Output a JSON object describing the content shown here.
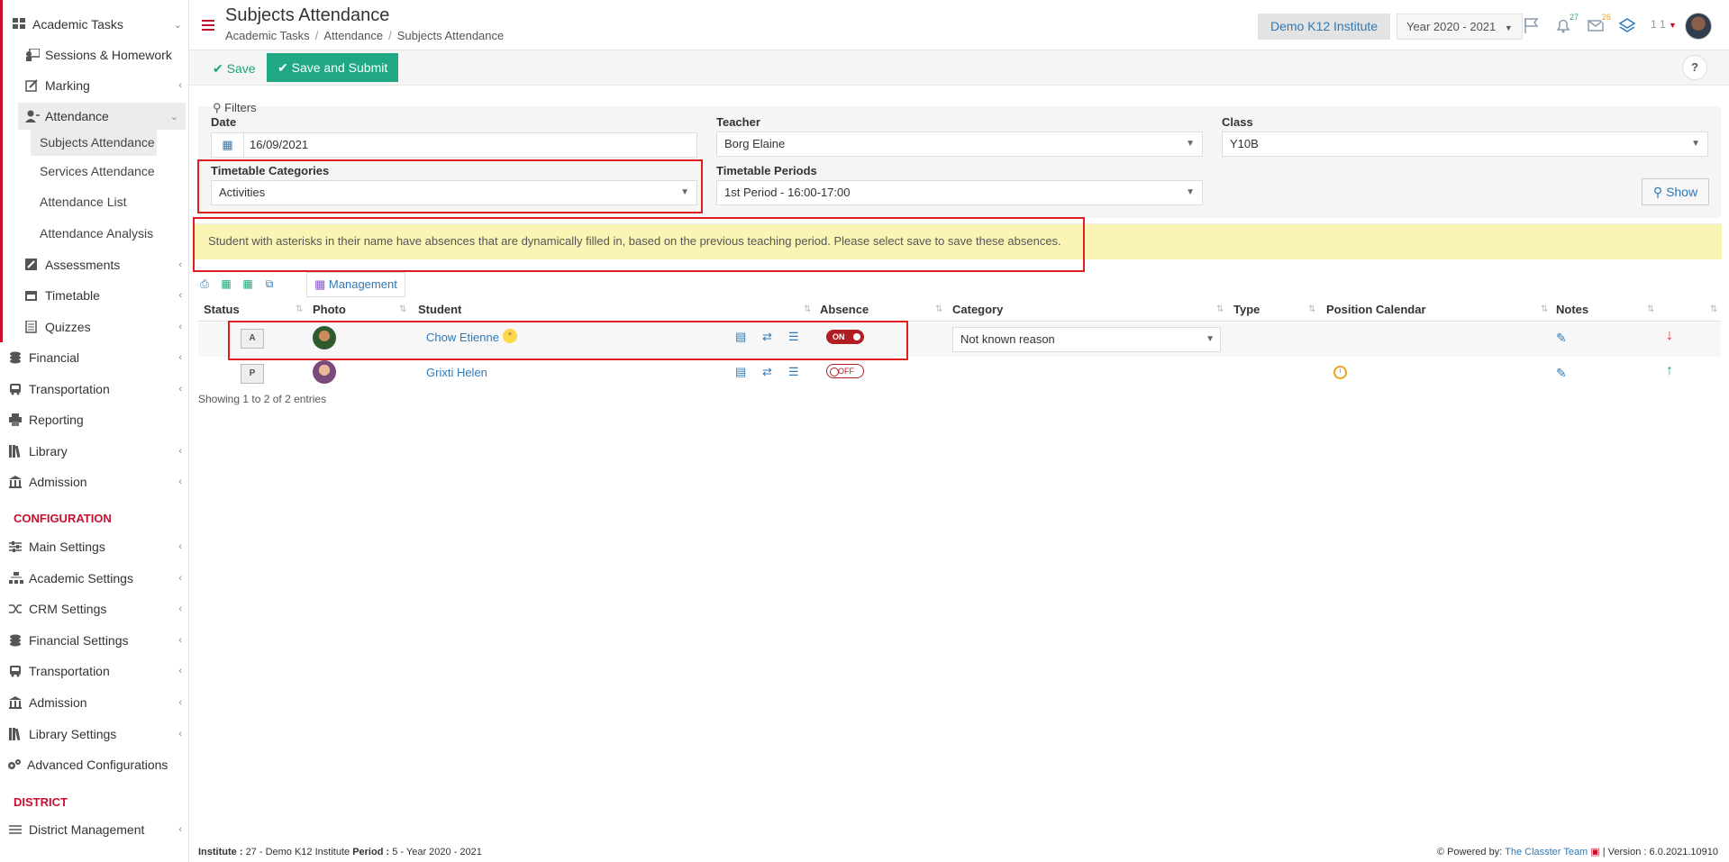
{
  "sidebar": {
    "items": [
      {
        "label": "Academic Tasks",
        "icon": "grid-icon",
        "has_chevron": true
      },
      {
        "label": "Sessions & Homework",
        "icon": "teacher-icon",
        "has_chevron": false
      },
      {
        "label": "Marking",
        "icon": "edit-icon",
        "has_chevron": true
      },
      {
        "label": "Attendance",
        "icon": "user-icon",
        "has_chevron": true
      },
      {
        "label": "Subjects Attendance",
        "icon": "",
        "has_chevron": false,
        "active": true
      },
      {
        "label": "Services Attendance",
        "icon": "",
        "has_chevron": false
      },
      {
        "label": "Attendance List",
        "icon": "",
        "has_chevron": false
      },
      {
        "label": "Attendance Analysis",
        "icon": "",
        "has_chevron": false
      },
      {
        "label": "Assessments",
        "icon": "pencil-square-icon",
        "has_chevron": true
      },
      {
        "label": "Timetable",
        "icon": "calendar-icon",
        "has_chevron": true
      },
      {
        "label": "Quizzes",
        "icon": "quiz-icon",
        "has_chevron": true
      },
      {
        "label": "Financial",
        "icon": "coins-icon",
        "has_chevron": true
      },
      {
        "label": "Transportation",
        "icon": "bus-icon",
        "has_chevron": true
      },
      {
        "label": "Reporting",
        "icon": "print-icon",
        "has_chevron": false
      },
      {
        "label": "Library",
        "icon": "books-icon",
        "has_chevron": true
      },
      {
        "label": "Admission",
        "icon": "institution-icon",
        "has_chevron": true
      }
    ],
    "config_title": "CONFIGURATION",
    "config_items": [
      {
        "label": "Main Settings",
        "icon": "sliders-icon"
      },
      {
        "label": "Academic Settings",
        "icon": "sitemap-icon"
      },
      {
        "label": "CRM Settings",
        "icon": "shuffle-icon"
      },
      {
        "label": "Financial Settings",
        "icon": "coins-icon"
      },
      {
        "label": "Transportation",
        "icon": "bus-icon"
      },
      {
        "label": "Admission",
        "icon": "institution-icon"
      },
      {
        "label": "Library Settings",
        "icon": "books-icon"
      },
      {
        "label": "Advanced Configurations",
        "icon": "gears-icon"
      }
    ],
    "district_title": "DISTRICT",
    "district_items": [
      {
        "label": "District Management",
        "icon": "list-icon"
      }
    ]
  },
  "header": {
    "title": "Subjects Attendance",
    "breadcrumb": [
      "Academic Tasks",
      "Attendance",
      "Subjects Attendance"
    ],
    "institute": "Demo K12 Institute",
    "year": "Year 2020 - 2021",
    "notifications_count": "27",
    "messages_count": "26",
    "user_short": "1 1"
  },
  "toolbar": {
    "save_label": "Save",
    "submit_label": "Save and Submit",
    "help_label": "?"
  },
  "filters": {
    "title": "Filters",
    "date_label": "Date",
    "date_value": "16/09/2021",
    "teacher_label": "Teacher",
    "teacher_value": "Borg Elaine",
    "class_label": "Class",
    "class_value": "Y10B",
    "categories_label": "Timetable Categories",
    "categories_value": "Activities",
    "periods_label": "Timetable Periods",
    "periods_value": "1st Period - 16:00-17:00",
    "show_label": "Show"
  },
  "note": "Student with asterisks in their name have absences that are dynamically filled in, based on the previous teaching period. Please select save to save these absences.",
  "table": {
    "management_label": "Management",
    "columns": [
      "Status",
      "Photo",
      "Student",
      "Absence",
      "Category",
      "Type",
      "Position Calendar",
      "Notes"
    ],
    "rows": [
      {
        "status": "A",
        "student": "Chow Etienne",
        "star": "*",
        "absence": "ON",
        "category": "Not known reason"
      },
      {
        "status": "P",
        "student": "Grixti Helen",
        "absence": "OFF",
        "category": ""
      }
    ],
    "showing": "Showing 1 to 2 of 2 entries"
  },
  "footer": {
    "institute_label": "Institute :",
    "institute_value": "27 - Demo K12 Institute",
    "period_label": "Period :",
    "period_value": "5 - Year 2020 - 2021",
    "powered_label": "Powered by:",
    "powered_link": "The Classter Team",
    "version": "| Version : 6.0.2021.10910"
  },
  "colors": {
    "accent_red": "#c8102e",
    "primary_blue": "#2f79b8",
    "success_green": "#20a884",
    "note_yellow": "#fbf5b5"
  }
}
